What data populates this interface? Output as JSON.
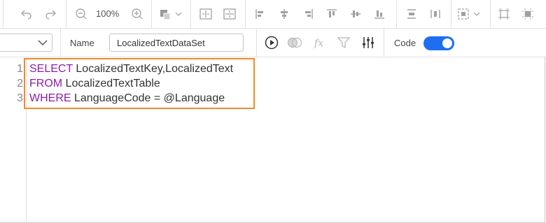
{
  "toolbar": {
    "zoom": "100%",
    "icons": [
      "undo-icon",
      "redo-icon",
      "zoom-out-icon",
      "zoom-in-icon",
      "fill-color-icon",
      "chevron-down-icon",
      "fit-width-icon",
      "fit-height-icon",
      "align-left-icon",
      "align-center-icon",
      "align-right-icon",
      "align-top-icon",
      "align-middle-icon",
      "align-bottom-icon",
      "distribute-vertical-icon",
      "distribute-horizontal-icon",
      "selection-icon",
      "snap-grid-icon",
      "snap-lines-icon"
    ]
  },
  "properties": {
    "name_label": "Name",
    "name_value": "LocalizedTextDataSet",
    "code_label": "Code",
    "code_enabled": true,
    "icons": [
      "run-query-icon",
      "toggle-view-icon",
      "function-icon",
      "filter-icon",
      "parameters-icon"
    ]
  },
  "editor": {
    "lines": [
      {
        "number": "1",
        "keyword": "SELECT",
        "rest": " LocalizedTextKey,LocalizedText"
      },
      {
        "number": "2",
        "keyword": "FROM",
        "rest": " LocalizedTextTable"
      },
      {
        "number": "3",
        "keyword": "WHERE",
        "rest": " LanguageCode = @Language"
      }
    ]
  },
  "colors": {
    "keyword": "#8b1ea8",
    "highlight": "#f08a2a",
    "toggle": "#1e6ff0"
  }
}
